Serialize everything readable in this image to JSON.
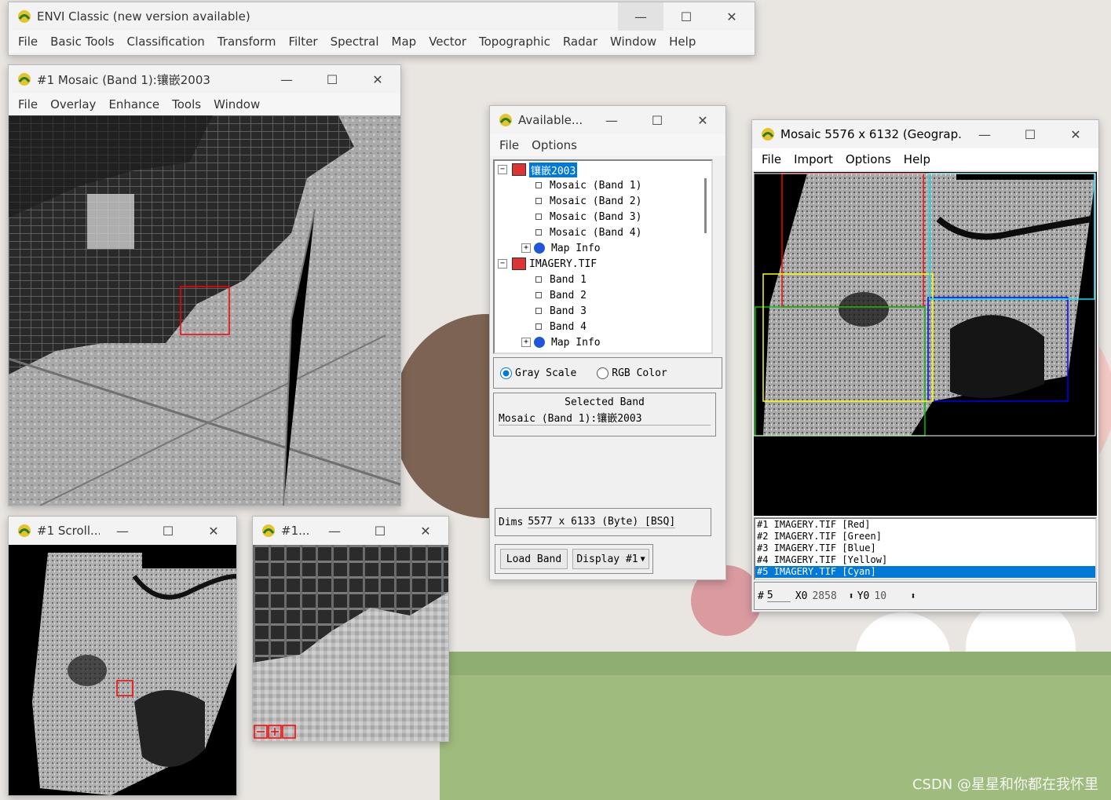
{
  "envi_main": {
    "title": "ENVI Classic (new version available)",
    "menu": [
      "File",
      "Basic Tools",
      "Classification",
      "Transform",
      "Filter",
      "Spectral",
      "Map",
      "Vector",
      "Topographic",
      "Radar",
      "Window",
      "Help"
    ]
  },
  "mosaic_window": {
    "title": "#1 Mosaic (Band 1):镶嵌2003",
    "menu": [
      "File",
      "Overlay",
      "Enhance",
      "Tools",
      "Window"
    ]
  },
  "scroll_window": {
    "title": "#1 Scroll..."
  },
  "zoom_window": {
    "title": "#1..."
  },
  "available_bands": {
    "title": "Available...",
    "menu": [
      "File",
      "Options"
    ],
    "tree": [
      {
        "label": "镶嵌2003",
        "level": 0,
        "expander": "−",
        "selected": true,
        "icon": "stack-icon"
      },
      {
        "label": "Mosaic (Band 1)",
        "level": 1,
        "icon": "band-icon"
      },
      {
        "label": "Mosaic (Band 2)",
        "level": 1,
        "icon": "band-icon"
      },
      {
        "label": "Mosaic (Band 3)",
        "level": 1,
        "icon": "band-icon"
      },
      {
        "label": "Mosaic (Band 4)",
        "level": 1,
        "icon": "band-icon"
      },
      {
        "label": "Map Info",
        "level": 1,
        "expander": "+",
        "icon": "globe-icon"
      },
      {
        "label": "IMAGERY.TIF",
        "level": 0,
        "expander": "−",
        "icon": "stack-icon"
      },
      {
        "label": "Band 1",
        "level": 1,
        "icon": "band-icon"
      },
      {
        "label": "Band 2",
        "level": 1,
        "icon": "band-icon"
      },
      {
        "label": "Band 3",
        "level": 1,
        "icon": "band-icon"
      },
      {
        "label": "Band 4",
        "level": 1,
        "icon": "band-icon"
      },
      {
        "label": "Map Info",
        "level": 1,
        "expander": "+",
        "icon": "globe-icon"
      }
    ],
    "gray_scale": "Gray Scale",
    "rgb_color": "RGB Color",
    "selected_band_label": "Selected Band",
    "selected_band_value": "Mosaic (Band 1):镶嵌2003",
    "dims_label": "Dims",
    "dims_value": "5577 x 6133 (Byte) [BSQ]",
    "load_band": "Load Band",
    "display_btn": "Display #1"
  },
  "mosaic_tool": {
    "title": "Mosaic 5576 x 6132 (Geograp...",
    "menu": [
      "File",
      "Import",
      "Options",
      "Help"
    ],
    "layers": [
      {
        "label": "#1 IMAGERY.TIF [Red]",
        "selected": false
      },
      {
        "label": "#2 IMAGERY.TIF [Green]",
        "selected": false
      },
      {
        "label": "#3 IMAGERY.TIF [Blue]",
        "selected": false
      },
      {
        "label": "#4 IMAGERY.TIF [Yellow]",
        "selected": false
      },
      {
        "label": "#5 IMAGERY.TIF [Cyan]",
        "selected": true
      }
    ],
    "hash_label": "#",
    "hash_value": "5",
    "x0_label": "X0",
    "x0_value": "2858",
    "y0_label": "Y0",
    "y0_value": "10",
    "frame_colors": {
      "red": "#ff0000",
      "green": "#00c000",
      "blue": "#0000ff",
      "yellow": "#ffff00",
      "cyan": "#00e5ff"
    }
  },
  "captions": {
    "minimize": "—",
    "maximize": "☐",
    "close": "✕"
  },
  "watermark": "CSDN @星星和你都在我怀里"
}
